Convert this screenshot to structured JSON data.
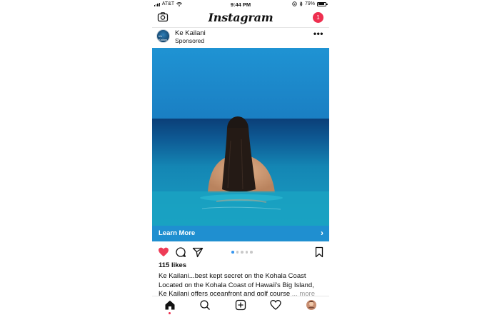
{
  "status_bar": {
    "carrier": "AT&T",
    "time": "9:44 PM",
    "battery_percent": "79%",
    "battery_level": 0.79
  },
  "top_bar": {
    "logo": "Instagram",
    "notification_count": "1",
    "icons": [
      "camera-icon",
      "notification-badge"
    ]
  },
  "post": {
    "account_name": "Ke Kailani",
    "sponsored_label": "Sponsored",
    "avatar_text": "Ke Kailani",
    "cta_label": "Learn More",
    "carousel": {
      "count": 5,
      "active_index": 0
    },
    "likes": "115 likes",
    "caption_line1": "Ke Kailani...best kept secret on the Kohala Coast",
    "caption_line2": "Located on the Kohala Coast of Hawaii's Big Island,",
    "caption_line3": "Ke Kailani offers oceanfront and golf course",
    "caption_more": "... more",
    "action_icons": [
      "heart-filled-icon",
      "comment-icon",
      "share-icon",
      "bookmark-icon"
    ]
  },
  "tab_bar": {
    "items": [
      "home-icon",
      "search-icon",
      "add-post-icon",
      "activity-heart-icon",
      "profile-avatar"
    ]
  },
  "colors": {
    "like_red": "#ee3c57",
    "notification_red": "#ee2f4f",
    "cta_blue": "#1f8fd0",
    "carousel_active": "#3897f0",
    "sky": "#1a8fce",
    "sea_deep": "#0a4f87"
  }
}
